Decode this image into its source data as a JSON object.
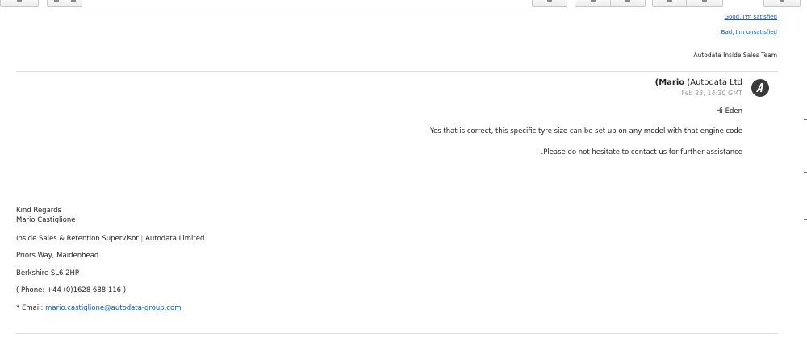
{
  "toolbar": {
    "buttons": [
      {
        "name": "reply-button",
        "icon": "reply-icon"
      },
      {
        "name": "prev-button",
        "icon": "chevron-left-icon"
      },
      {
        "name": "next-button",
        "icon": "chevron-right-icon"
      },
      {
        "name": "more-button",
        "icon": "more-icon"
      },
      {
        "name": "forward-button",
        "icon": "forward-icon"
      },
      {
        "name": "print-button",
        "icon": "print-icon"
      },
      {
        "name": "delete-button",
        "icon": "trash-icon"
      },
      {
        "name": "archive-button",
        "icon": "archive-icon"
      },
      {
        "name": "settings-button",
        "icon": "gear-icon"
      }
    ]
  },
  "feedback": {
    "good": "Good, I'm satisfied",
    "bad": "Bad, I'm unsatisfied",
    "team": "Autodata Inside Sales Team"
  },
  "message": {
    "sender_name": "Mario",
    "sender_org": "(Autodata Ltd",
    "sender_prefix": "(",
    "date": "Feb 23, 14:30 GMT",
    "greeting": "Hi Eden",
    "line1": ".Yes that is correct, this specific tyre size can be set up on any model with that engine code",
    "line2": ".Please do not hesitate to contact us for further assistance"
  },
  "signature": {
    "regards": "Kind  Regards",
    "name": "Mario Castiglione",
    "title": "Inside Sales & Retention Supervisor",
    "company": "Autodata Limited",
    "address1": "Priors Way, Maidenhead",
    "address2": "Berkshire SL6 2HP",
    "phone": "( Phone: +44 (0)1628 688 116 )",
    "email_label": "* Email: ",
    "email": "mario.castiglione@autodata-group.com"
  },
  "colors": {
    "link": "#1155cc",
    "muted": "#9a9a9a",
    "avatar_bg": "#3a3a3a"
  }
}
